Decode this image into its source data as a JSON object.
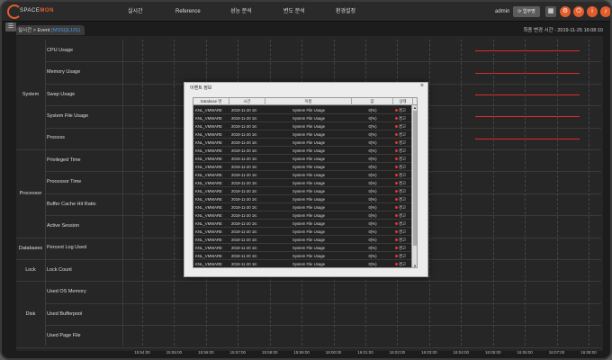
{
  "header": {
    "logo_text": "SPACE",
    "logo_accent": "MON",
    "nav": [
      "실시간",
      "Reference",
      "성능 분석",
      "변도 분석",
      "환경설정"
    ],
    "user": "admin",
    "update_button": "업무명"
  },
  "breadcrumb": {
    "prefix": "실시간 > Event",
    "highlight": "(MSSQL101)",
    "last_change": "최종 변경 시간 : 2019-11-25 16:08:10"
  },
  "chart": {
    "groups": [
      {
        "name": "System"
      },
      {
        "name": "Processor"
      },
      {
        "name": "Databases"
      },
      {
        "name": "Lock"
      },
      {
        "name": "Disk"
      }
    ],
    "metrics": [
      "CPU Usage",
      "Memory Usage",
      "Swap Usage",
      "System File Usage",
      "Process",
      "Privileged Time",
      "Processor Time",
      "Buffer Cache Hit Ratio",
      "Active Session",
      "Percent Log Used",
      "Lock Count",
      "Used OS Memory",
      "Used Bufferpool",
      "Used Page File"
    ],
    "x_ticks": [
      "15:54:00",
      "15:55:00",
      "15:56:00",
      "15:57:00",
      "15:58:00",
      "15:59:00",
      "16:00:00",
      "16:01:00",
      "16:02:00",
      "16:03:00",
      "16:04:00",
      "16:05:00",
      "16:06:00",
      "16:07:00",
      "16:08:00"
    ],
    "alert_color": "#e02a2a",
    "alert_rows": [
      "CPU Usage",
      "Memory Usage",
      "Swap Usage",
      "System File Usage",
      "Process"
    ]
  },
  "dialog": {
    "title": "이벤트 정보",
    "close": "×",
    "columns": [
      "Database 명",
      "시간",
      "이름",
      "값",
      "상태"
    ],
    "rows": [
      [
        "KNL_VMWARE",
        "2019-11-20 16:",
        "System File Usage",
        "0(%)",
        "경고"
      ],
      [
        "KNL_VMWARE",
        "2019-11-20 16:",
        "System File Usage",
        "0(%)",
        "경고"
      ],
      [
        "KNL_VMWARE",
        "2019-11-20 16:",
        "System File Usage",
        "0(%)",
        "경고"
      ],
      [
        "KNL_VMWARE",
        "2019-11-20 16:",
        "System File Usage",
        "0(%)",
        "경고"
      ],
      [
        "KNL_VMWARE",
        "2019-11-20 16:",
        "System File Usage",
        "0(%)",
        "경고"
      ],
      [
        "KNL_VMWARE",
        "2019-11-20 16:",
        "System File Usage",
        "0(%)",
        "경고"
      ],
      [
        "KNL_VMWARE",
        "2019-11-20 16:",
        "System File Usage",
        "0(%)",
        "경고"
      ],
      [
        "KNL_VMWARE",
        "2019-11-20 16:",
        "System File Usage",
        "0(%)",
        "경고"
      ],
      [
        "KNL_VMWARE",
        "2019-11-20 16:",
        "System File Usage",
        "0(%)",
        "경고"
      ],
      [
        "KNL_VMWARE",
        "2019-11-20 16:",
        "System File Usage",
        "0(%)",
        "경고"
      ],
      [
        "KNL_VMWARE",
        "2019-11-20 16:",
        "System File Usage",
        "0(%)",
        "경고"
      ],
      [
        "KNL_VMWARE",
        "2019-11-20 16:",
        "System File Usage",
        "0(%)",
        "경고"
      ],
      [
        "KNL_VMWARE",
        "2019-11-20 16:",
        "System File Usage",
        "0(%)",
        "경고"
      ],
      [
        "KNL_VMWARE",
        "2019-11-20 16:",
        "System File Usage",
        "0(%)",
        "경고"
      ],
      [
        "KNL_VMWARE",
        "2019-11-20 16:",
        "System File Usage",
        "0(%)",
        "경고"
      ],
      [
        "KNL_VMWARE",
        "2019-11-20 16:",
        "System File Usage",
        "0(%)",
        "경고"
      ],
      [
        "KNL_VMWARE",
        "2019-11-20 16:",
        "System File Usage",
        "0(%)",
        "경고"
      ],
      [
        "KNL_VMWARE",
        "2019-11-20 16:",
        "System File Usage",
        "0(%)",
        "경고"
      ],
      [
        "KNL_VMWARE",
        "2019-11-20 16:",
        "System File Usage",
        "0(%)",
        "경고"
      ],
      [
        "KNL_VMWARE",
        "2019-11-20 16:",
        "System File Usage",
        "0(%)",
        "경고"
      ]
    ],
    "status_color": "#e33333"
  },
  "icons": {
    "menu": "menu-icon",
    "refresh": "refresh-icon",
    "grid": "grid-icon",
    "settings": "settings-icon",
    "power": "power-icon",
    "info": "info-icon",
    "bell": "bell-icon"
  }
}
